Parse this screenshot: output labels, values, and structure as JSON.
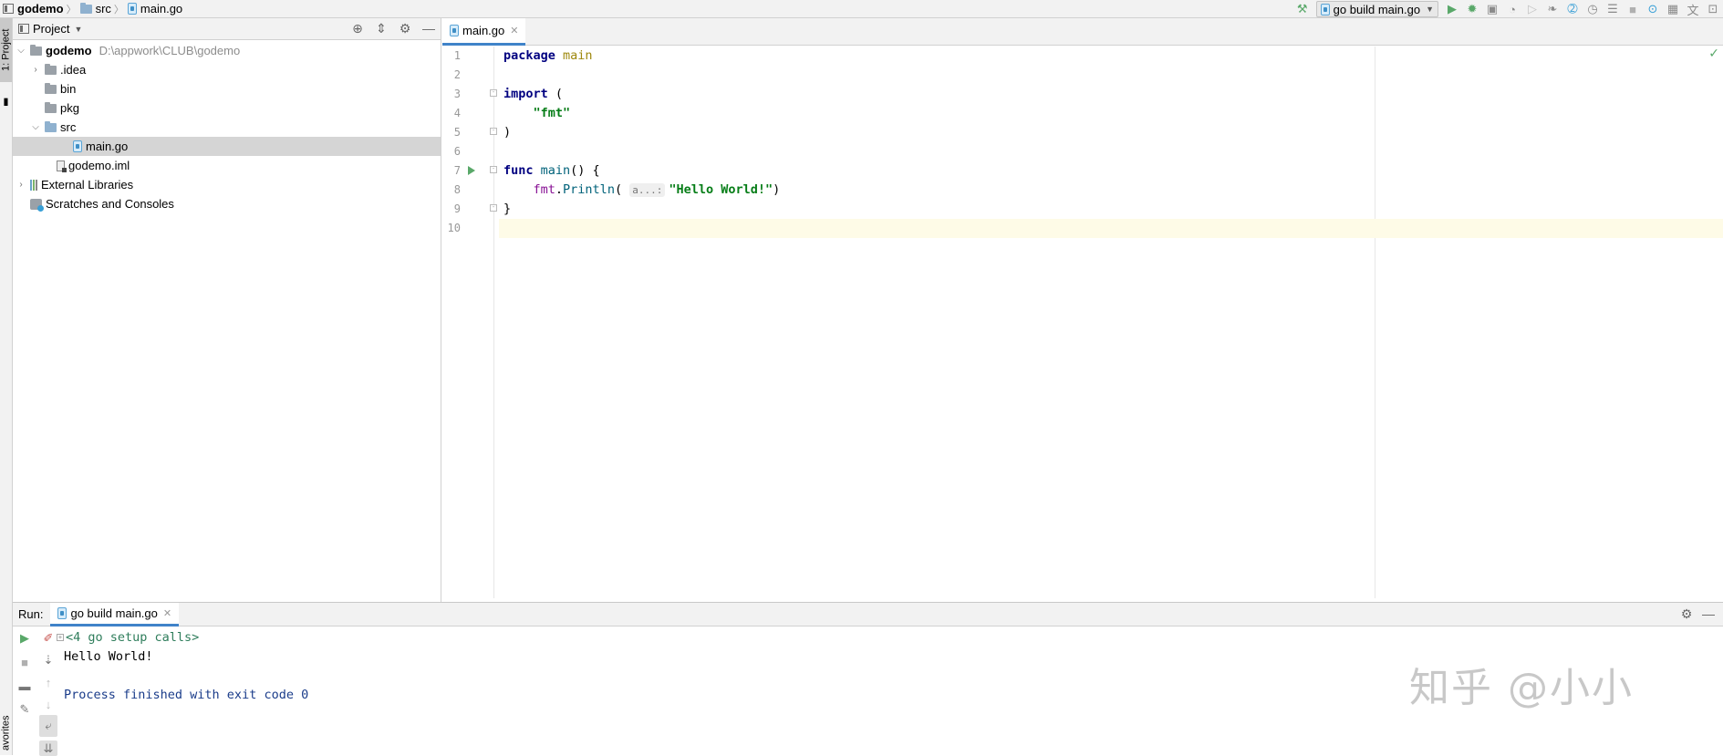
{
  "breadcrumb": {
    "project": "godemo",
    "folder": "src",
    "file": "main.go"
  },
  "toolbar": {
    "run_config": "go build main.go"
  },
  "left_stripe": {
    "project_tab": "1: Project",
    "favorites_tab": "avorites"
  },
  "project_panel": {
    "title": "Project",
    "tree": [
      {
        "label": "godemo",
        "path": "D:\\appwork\\CLUB\\godemo",
        "depth": 0,
        "expanded": true,
        "icon": "folder-icon"
      },
      {
        "label": ".idea",
        "depth": 1,
        "expanded": false,
        "icon": "folder-icon"
      },
      {
        "label": "bin",
        "depth": 1,
        "icon": "folder-icon"
      },
      {
        "label": "pkg",
        "depth": 1,
        "icon": "folder-icon"
      },
      {
        "label": "src",
        "depth": 1,
        "expanded": true,
        "icon": "folder-icon"
      },
      {
        "label": "main.go",
        "depth": 2,
        "selected": true,
        "icon": "go-file-icon"
      },
      {
        "label": "godemo.iml",
        "depth": 1,
        "icon": "iml-file-icon"
      },
      {
        "label": "External Libraries",
        "depth": 0,
        "expanded": false,
        "icon": "libraries-icon"
      },
      {
        "label": "Scratches and Consoles",
        "depth": 0,
        "icon": "scratches-icon"
      }
    ]
  },
  "editor": {
    "tab_label": "main.go",
    "line_numbers": [
      "1",
      "2",
      "3",
      "4",
      "5",
      "6",
      "7",
      "8",
      "9",
      "10"
    ],
    "code": {
      "l1_kw": "package",
      "l1_name": "main",
      "l3_kw": "import",
      "l3_paren": "(",
      "l4_str": "\"fmt\"",
      "l5": ")",
      "l7_kw": "func",
      "l7_fn": "main",
      "l7_rest": "() {",
      "l8_pkg": "fmt",
      "l8_fn": "Println",
      "l8_hint": "a...:",
      "l8_str": "\"Hello World!\"",
      "l8_close": ")",
      "l9": "}"
    }
  },
  "run_panel": {
    "label": "Run:",
    "tab_label": "go build main.go",
    "console": {
      "setup": "<4 go setup calls>",
      "output": "Hello World!",
      "exit": "Process finished with exit code 0"
    }
  },
  "watermark": "知乎 @小小",
  "colors": {
    "accent": "#4083c9",
    "run_green": "#59a869",
    "selection": "#d5d5d5",
    "current_line": "#fefbe7"
  }
}
